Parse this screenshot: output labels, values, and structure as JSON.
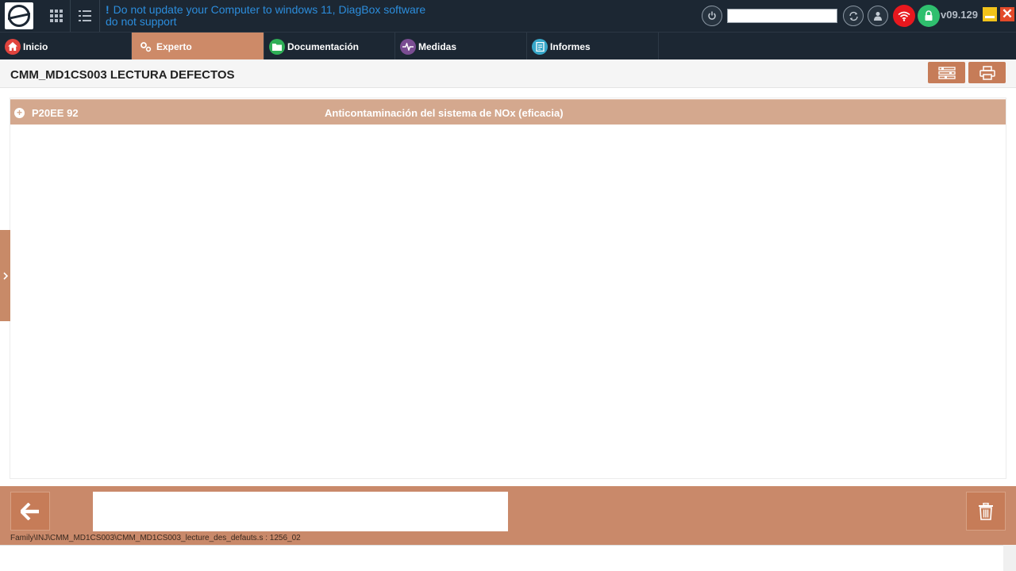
{
  "topbar": {
    "warning": "Do not update your Computer to windows 11, DiagBox software do not support",
    "warning_mark": "!",
    "version": "v09.129",
    "close_glyph": "✕",
    "icons": [
      "apps-grid-icon",
      "list-icon",
      "power-icon",
      "refresh-icon",
      "user-icon",
      "wifi-icon",
      "lock-icon"
    ]
  },
  "nav": {
    "tabs": [
      {
        "label": "Inicio",
        "icon": "home-icon",
        "color": "#e0433d"
      },
      {
        "label": "Experto",
        "icon": "gears-icon",
        "color": "#cd8a68"
      },
      {
        "label": "Documentación",
        "icon": "folder-icon",
        "color": "#2fae57"
      },
      {
        "label": "Medidas",
        "icon": "pulse-icon",
        "color": "#7a4d92"
      },
      {
        "label": "Informes",
        "icon": "report-icon",
        "color": "#37a7c9"
      }
    ],
    "active_tab": "Experto"
  },
  "header": {
    "title": "CMM_MD1CS003 LECTURA DEFECTOS"
  },
  "faults": [
    {
      "code": "P20EE 92",
      "description": "Anticontaminación del sistema de NOx (eficacia)"
    }
  ],
  "footer": {
    "path": "Family\\INJ\\CMM_MD1CS003\\CMM_MD1CS003_lecture_des_defauts.s : 1256_02",
    "input_value": ""
  },
  "colors": {
    "accent": "#c67c58",
    "dark": "#1c2733",
    "fault_row": "#d4a88e",
    "warning_text": "#2c8ddc"
  }
}
